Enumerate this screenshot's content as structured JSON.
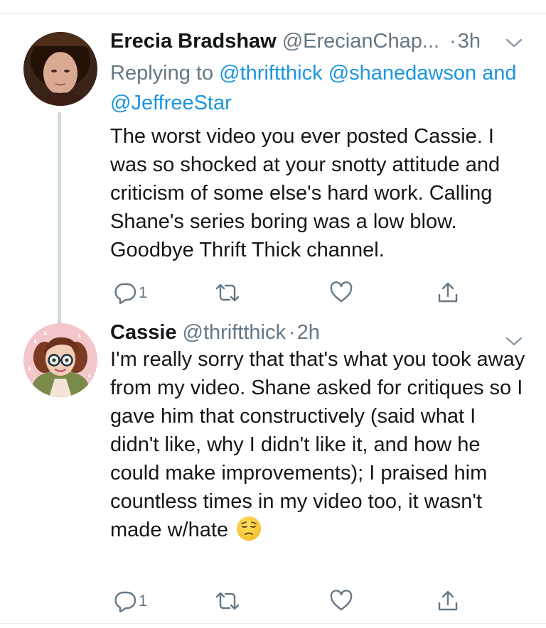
{
  "tweets": [
    {
      "display_name": "Erecia Bradshaw",
      "handle": "@ErecianChap...",
      "time": "3h",
      "replying_prefix": "Replying to",
      "replying_to": [
        "@thriftthick",
        "@shanedawson",
        "@JeffreeStar"
      ],
      "replying_conjunction": "and",
      "text": "The worst video you ever posted Cassie. I was so shocked at your snotty attitude and criticism of some else's hard work. Calling Shane's series boring was a low blow. Goodbye Thrift Thick channel.",
      "reply_count": "1",
      "icons": {
        "reply": "reply-icon",
        "retweet": "retweet-icon",
        "like": "heart-icon",
        "share": "share-icon",
        "menu": "chevron-down-icon"
      }
    },
    {
      "display_name": "Cassie",
      "handle": "@thriftthick",
      "time": "2h",
      "text": "I'm really sorry that that's what you took away from my video. Shane asked for critiques so I gave him that constructively (said what I didn't like, why I didn't like it, and how he could make improvements); I praised him countless times in my video too, it wasn't made w/hate",
      "emoji": "pensive-face",
      "reply_count": "1",
      "icons": {
        "reply": "reply-icon",
        "retweet": "retweet-icon",
        "like": "heart-icon",
        "share": "share-icon",
        "menu": "chevron-down-icon"
      }
    }
  ],
  "colors": {
    "link": "#1b95e0",
    "secondary": "#657786",
    "text": "#14171a",
    "divider": "#e6ecf0"
  }
}
